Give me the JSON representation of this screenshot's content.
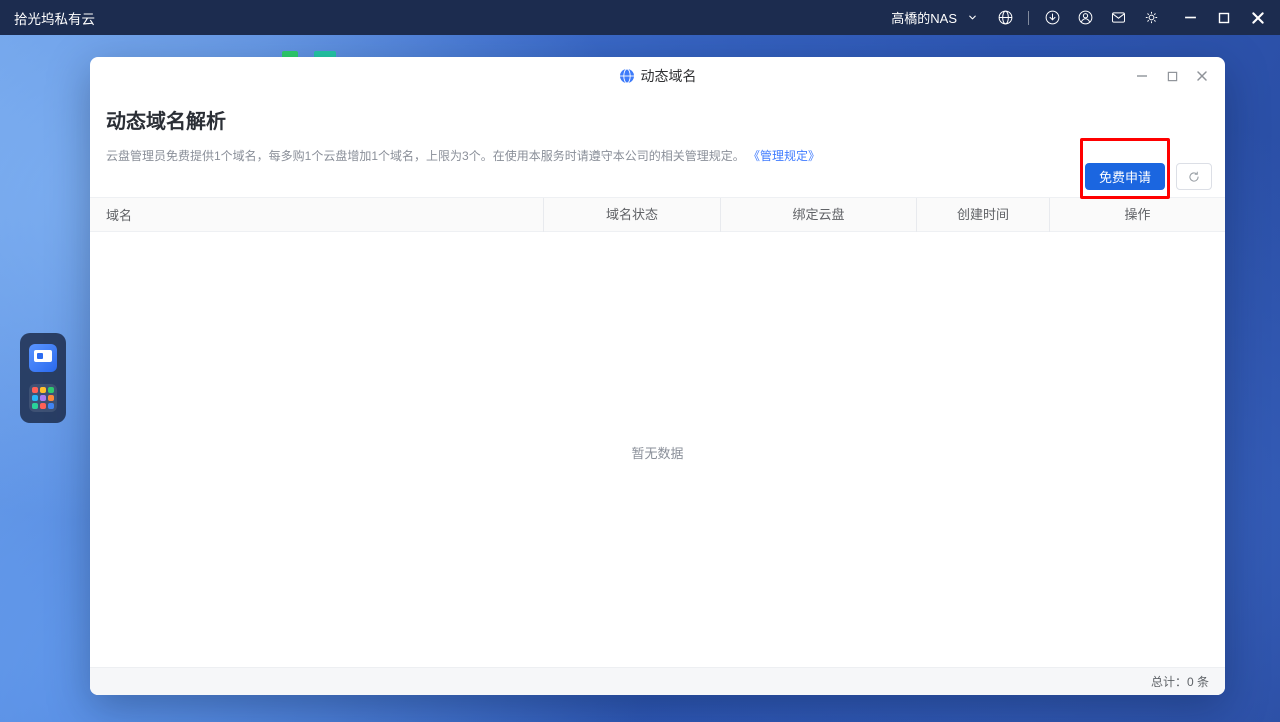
{
  "topbar": {
    "app_title": "拾光坞私有云",
    "account_name": "高橋的NAS",
    "icons": [
      "globe-icon",
      "download-circle-icon",
      "account-icon",
      "mail-icon",
      "settings-icon"
    ]
  },
  "dock": {
    "items": [
      "screen-app-icon",
      "app-grid-icon"
    ]
  },
  "dialog": {
    "title": "动态域名",
    "title_icon": "globe-icon",
    "heading": "动态域名解析",
    "description": "云盘管理员免费提供1个域名，每多购1个云盘增加1个域名，上限为3个。在使用本服务时请遵守本公司的相关管理规定。",
    "policy_link": "《管理规定》",
    "apply_button_label": "免费申请",
    "refresh_icon": "refresh-icon",
    "table": {
      "columns": [
        "域名",
        "域名状态",
        "绑定云盘",
        "创建时间",
        "操作"
      ],
      "rows": [],
      "empty_text": "暂无数据"
    },
    "total_text": "总计：0 条"
  },
  "colors": {
    "topbar_bg": "#1c2c4f",
    "primary_blue": "#1b66e0",
    "link_blue": "#3f7bff",
    "annotation_red": "#ff0000"
  }
}
